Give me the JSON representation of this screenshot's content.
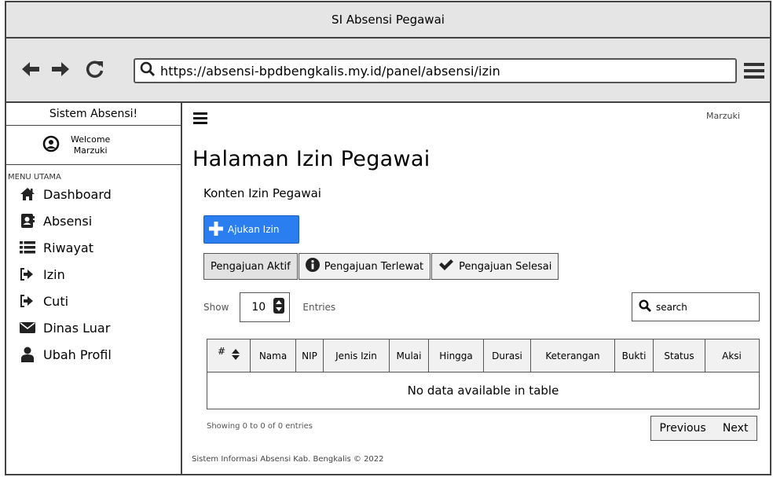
{
  "window": {
    "title": "SI Absensi Pegawai"
  },
  "browser": {
    "url": "https://absensi-bpdbengkalis.my.id/panel/absensi/izin"
  },
  "sidebar": {
    "title": "Sistem Absensi!",
    "welcome_line1": "Welcome",
    "welcome_line2": "Marzuki",
    "section_label": "MENU UTAMA",
    "items": [
      {
        "label": "Dashboard",
        "icon": "home-icon"
      },
      {
        "label": "Absensi",
        "icon": "contact-book-icon"
      },
      {
        "label": "Riwayat",
        "icon": "list-icon"
      },
      {
        "label": "Izin",
        "icon": "sign-in-icon"
      },
      {
        "label": "Cuti",
        "icon": "sign-in-icon"
      },
      {
        "label": "Dinas Luar",
        "icon": "envelope-icon"
      },
      {
        "label": "Ubah Profil",
        "icon": "user-icon"
      }
    ]
  },
  "header": {
    "user_name": "Marzuki"
  },
  "main": {
    "page_title": "Halaman Izin Pegawai",
    "sub_title": "Konten Izin Pegawai",
    "primary_button": "Ajukan Izin",
    "tabs": [
      {
        "label": "Pengajuan Aktif",
        "icon": ""
      },
      {
        "label": "Pengajuan Terlewat",
        "icon": "info-icon"
      },
      {
        "label": "Pengajuan Selesai",
        "icon": "check-icon"
      }
    ],
    "show_label": "Show",
    "entries_value": "10",
    "entries_label": "Entries",
    "search_placeholder": "search",
    "table": {
      "columns": [
        "#",
        "Nama",
        "NIP",
        "Jenis Izin",
        "Mulai",
        "Hingga",
        "Durasi",
        "Keterangan",
        "Bukti",
        "Status",
        "Aksi"
      ],
      "empty_message": "No data available in table"
    },
    "showing_text": "Showing 0 to 0 of 0 entries",
    "pager": {
      "previous": "Previous",
      "next": "Next"
    },
    "footer": "Sistem Informasi Absensi Kab. Bengkalis © 2022"
  },
  "colors": {
    "primary": "#2a7ef0",
    "chrome": "#e5e5e5",
    "border": "#444444"
  }
}
